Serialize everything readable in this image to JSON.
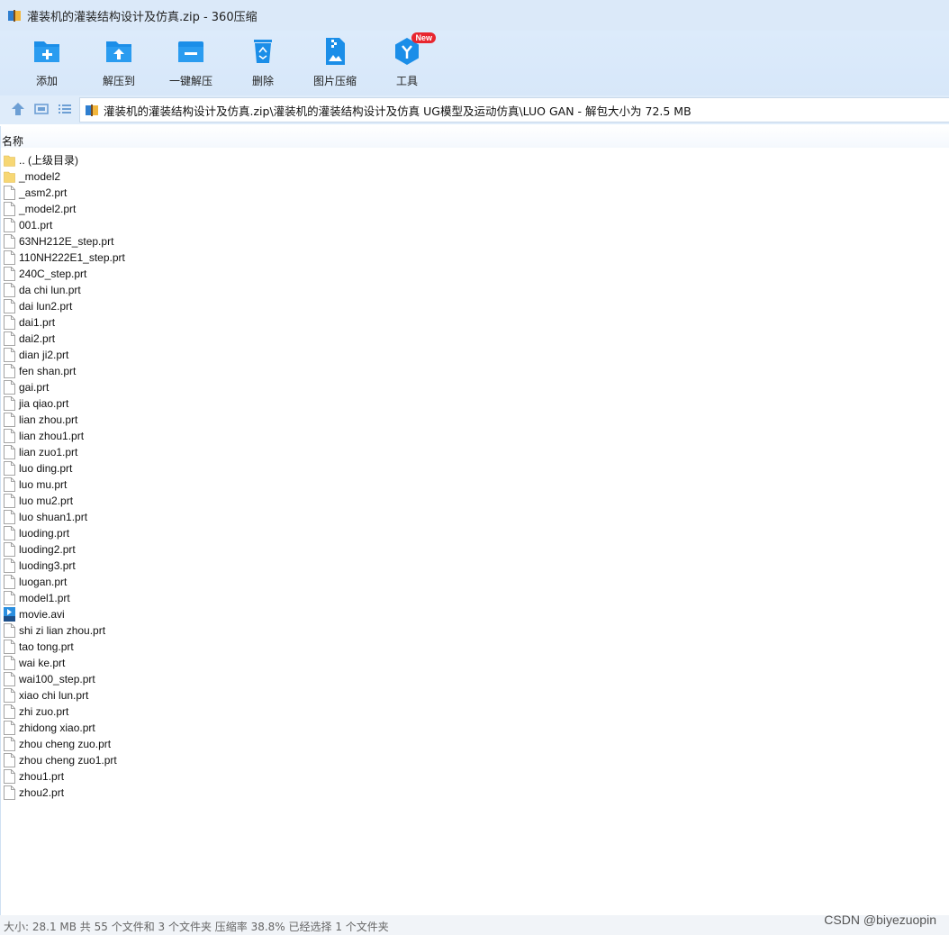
{
  "window": {
    "title": "灌装机的灌装结构设计及仿真.zip - 360压缩"
  },
  "toolbar": {
    "add": "添加",
    "extract_to": "解压到",
    "one_click_extract": "一键解压",
    "delete": "删除",
    "image_compress": "图片压缩",
    "tools": "工具",
    "tools_badge": "New"
  },
  "address": {
    "path": "灌装机的灌装结构设计及仿真.zip\\灌装机的灌装结构设计及仿真 UG模型及运动仿真\\LUO GAN - 解包大小为 72.5 MB"
  },
  "columns": {
    "name": "名称"
  },
  "files": [
    {
      "name": ".. (上级目录)",
      "type": "folder"
    },
    {
      "name": "_model2",
      "type": "folder"
    },
    {
      "name": "_asm2.prt",
      "type": "file"
    },
    {
      "name": "_model2.prt",
      "type": "file"
    },
    {
      "name": "001.prt",
      "type": "file"
    },
    {
      "name": "63NH212E_step.prt",
      "type": "file"
    },
    {
      "name": "110NH222E1_step.prt",
      "type": "file"
    },
    {
      "name": "240C_step.prt",
      "type": "file"
    },
    {
      "name": "da chi lun.prt",
      "type": "file"
    },
    {
      "name": "dai lun2.prt",
      "type": "file"
    },
    {
      "name": "dai1.prt",
      "type": "file"
    },
    {
      "name": "dai2.prt",
      "type": "file"
    },
    {
      "name": "dian ji2.prt",
      "type": "file"
    },
    {
      "name": "fen shan.prt",
      "type": "file"
    },
    {
      "name": "gai.prt",
      "type": "file"
    },
    {
      "name": "jia qiao.prt",
      "type": "file"
    },
    {
      "name": "lian zhou.prt",
      "type": "file"
    },
    {
      "name": "lian zhou1.prt",
      "type": "file"
    },
    {
      "name": "lian zuo1.prt",
      "type": "file"
    },
    {
      "name": "luo ding.prt",
      "type": "file"
    },
    {
      "name": "luo mu.prt",
      "type": "file"
    },
    {
      "name": "luo mu2.prt",
      "type": "file"
    },
    {
      "name": "luo shuan1.prt",
      "type": "file"
    },
    {
      "name": "luoding.prt",
      "type": "file"
    },
    {
      "name": "luoding2.prt",
      "type": "file"
    },
    {
      "name": "luoding3.prt",
      "type": "file"
    },
    {
      "name": "luogan.prt",
      "type": "file"
    },
    {
      "name": "model1.prt",
      "type": "file"
    },
    {
      "name": "movie.avi",
      "type": "video"
    },
    {
      "name": "shi zi lian zhou.prt",
      "type": "file"
    },
    {
      "name": "tao tong.prt",
      "type": "file"
    },
    {
      "name": "wai ke.prt",
      "type": "file"
    },
    {
      "name": "wai100_step.prt",
      "type": "file"
    },
    {
      "name": "xiao chi lun.prt",
      "type": "file"
    },
    {
      "name": "zhi zuo.prt",
      "type": "file"
    },
    {
      "name": "zhidong xiao.prt",
      "type": "file"
    },
    {
      "name": "zhou cheng zuo.prt",
      "type": "file"
    },
    {
      "name": "zhou cheng zuo1.prt",
      "type": "file"
    },
    {
      "name": "zhou1.prt",
      "type": "file"
    },
    {
      "name": "zhou2.prt",
      "type": "file"
    }
  ],
  "status": {
    "text": "大小: 28.1 MB 共 55 个文件和 3 个文件夹 压缩率 38.8% 已经选择 1 个文件夹",
    "watermark": "CSDN @biyezuopin"
  },
  "colors": {
    "accent": "#1b8ee8",
    "toolbar_bg": "#dcebfb",
    "folder": "#f7d774"
  }
}
